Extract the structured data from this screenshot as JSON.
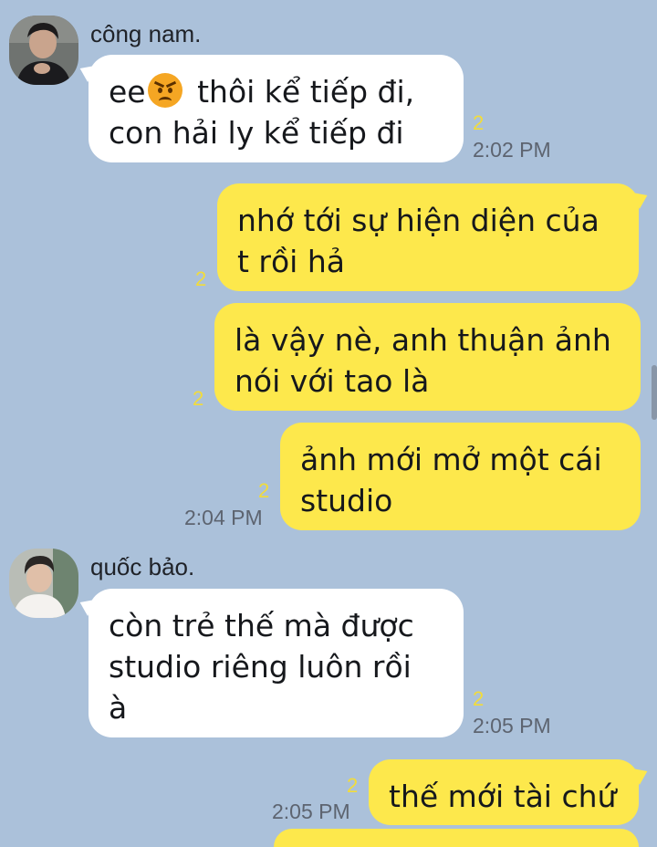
{
  "messages": [
    {
      "sender": "công nam.",
      "avatar": "young-man-in-black-shirt-avatar",
      "lines": [
        "thôi kể tiếp đi,",
        "con hải ly kể tiếp đi"
      ],
      "line1_prefix": "ee",
      "emoji": "angry-face-emoji",
      "read_count": "2",
      "time": "2:02 PM"
    },
    {
      "lines": [
        "nhớ tới sự hiện diện của",
        "t rồi hả"
      ],
      "read_count": "2"
    },
    {
      "lines": [
        "là vậy nè, anh thuận ảnh",
        "nói với tao là"
      ],
      "read_count": "2"
    },
    {
      "lines": [
        "ảnh mới mở một cái",
        "studio"
      ],
      "read_count": "2",
      "time": "2:04 PM"
    },
    {
      "sender": "quốc bảo.",
      "avatar": "young-man-in-white-shirt-avatar",
      "lines": [
        "còn trẻ thế mà được",
        "studio riêng luôn rồi",
        "à"
      ],
      "read_count": "2",
      "time": "2:05 PM"
    },
    {
      "lines": [
        "thế mới tài chứ"
      ],
      "read_count": "2",
      "time": "2:05 PM"
    }
  ],
  "colors": {
    "background": "#abc1da",
    "outgoing": "#fde84c",
    "incoming": "#ffffff",
    "read_count": "#f2dc3a"
  }
}
